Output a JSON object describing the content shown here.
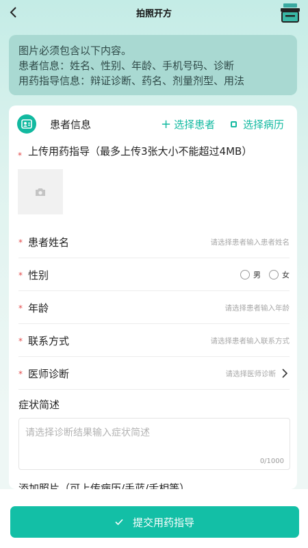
{
  "header": {
    "title": "拍照开方"
  },
  "notice": {
    "line1": "图片必须包含以下内容。",
    "line2": "患者信息：姓名、性别、年龄、手机号码、诊断",
    "line3": "用药指导信息：辩证诊断、药名、剂量剂型、用法"
  },
  "card": {
    "title": "患者信息",
    "select_patient": "选择患者",
    "select_record": "选择病历",
    "upload_label": "上传用药指导（最多上传3张大小不能超过4MB）",
    "fields": [
      {
        "label": "患者姓名",
        "placeholder": "请选择患者输入患者姓名"
      },
      {
        "label": "性别",
        "options": [
          "男",
          "女"
        ]
      },
      {
        "label": "年龄",
        "placeholder": "请选择患者输入年龄"
      },
      {
        "label": "联系方式",
        "placeholder": "请选择患者输入联系方式"
      },
      {
        "label": "医师诊断",
        "placeholder": "请选择医师诊断"
      }
    ],
    "symptom_label": "症状简述",
    "symptom_placeholder": "请选择诊断结果输入症状简述",
    "symptom_count": "0/1000",
    "photo_label": "添加照片（可上传病历/手蓝/舌相等）"
  },
  "submit": {
    "label": "提交用药指导"
  },
  "colors": {
    "accent": "#13bfa6",
    "required": "#e24b4b"
  }
}
